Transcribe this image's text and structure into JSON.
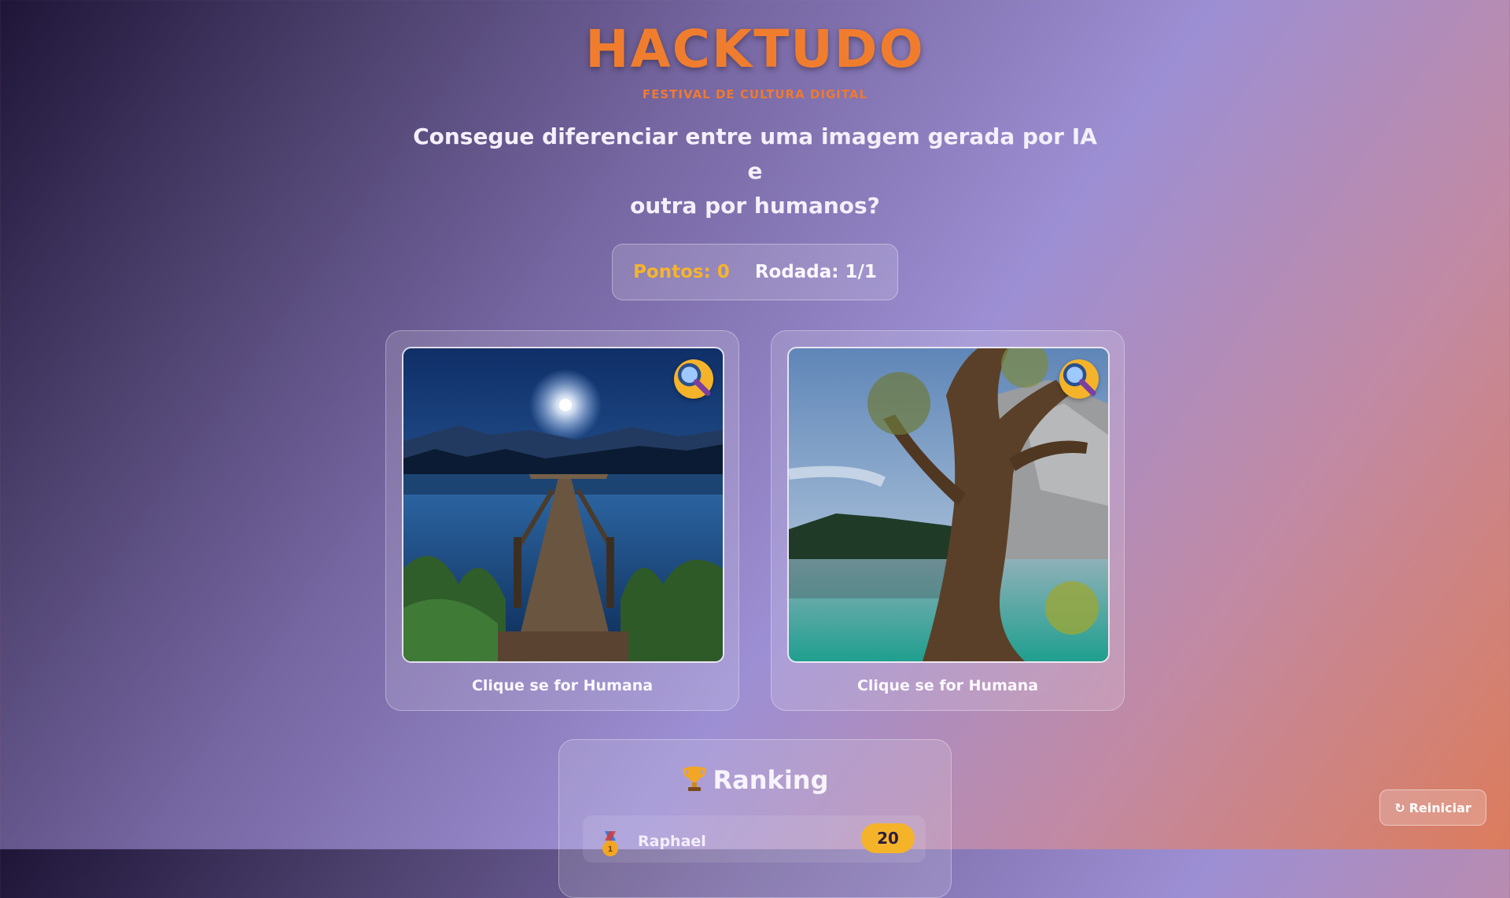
{
  "header": {
    "title": "HACKTUDO",
    "subtitle": "FESTIVAL DE CULTURA DIGITAL",
    "question_line1": "Consegue diferenciar entre uma imagem gerada por IA e",
    "question_line2": "outra por humanos?"
  },
  "score": {
    "points_text": "Pontos: 0",
    "round_text": "Rodada: 1/1"
  },
  "cards": [
    {
      "image": "moonlit-lake-dock-photo",
      "zoom_icon": "magnifier-icon",
      "label": "Clique se for Humana"
    },
    {
      "image": "tree-by-turquoise-lake-photo",
      "zoom_icon": "magnifier-icon",
      "label": "Clique se for Humana"
    }
  ],
  "ranking": {
    "title": "Ranking",
    "title_icon": "trophy-icon",
    "entries": [
      {
        "medal_icon": "medal-icon",
        "name": "Raphael",
        "score": "20"
      }
    ]
  },
  "reset": {
    "icon": "refresh-icon",
    "label": "Reiniciar"
  },
  "colors": {
    "accent_orange": "#f07d2e",
    "accent_yellow": "#f5b32a"
  }
}
